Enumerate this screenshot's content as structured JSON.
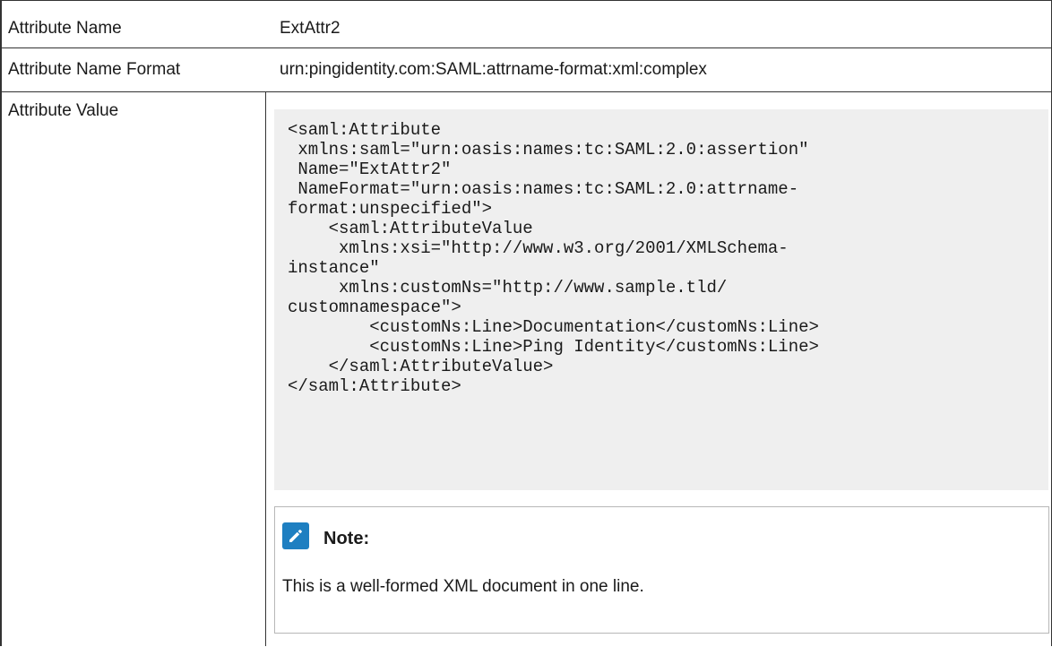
{
  "rows": [
    {
      "label": "Attribute Name",
      "value": "ExtAttr2"
    },
    {
      "label": "Attribute Name Format",
      "value": "urn:pingidentity.com:SAML:attrname-format:xml:complex"
    },
    {
      "label": "Attribute Value"
    }
  ],
  "code": "<saml:Attribute\n xmlns:saml=\"urn:oasis:names:tc:SAML:2.0:assertion\"\n Name=\"ExtAttr2\"\n NameFormat=\"urn:oasis:names:tc:SAML:2.0:attrname-\nformat:unspecified\">\n    <saml:AttributeValue\n     xmlns:xsi=\"http://www.w3.org/2001/XMLSchema-\ninstance\"\n     xmlns:customNs=\"http://www.sample.tld/\ncustomnamespace\">\n        <customNs:Line>Documentation</customNs:Line>\n        <customNs:Line>Ping Identity</customNs:Line>\n    </saml:AttributeValue>\n</saml:Attribute>",
  "note": {
    "icon": "pencil-icon",
    "title": "Note:",
    "body": "This is a well-formed XML document in one line."
  },
  "colors": {
    "note_icon": "#1e7fc1",
    "code_background": "#efefef"
  }
}
